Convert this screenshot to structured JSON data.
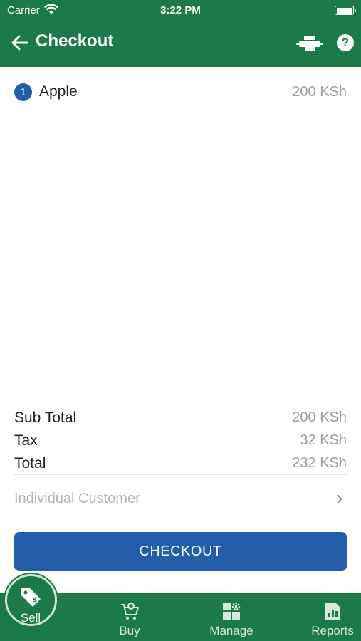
{
  "status_bar": {
    "carrier": "Carrier",
    "time": "3:22 PM"
  },
  "header": {
    "title": "Checkout",
    "back_icon": "arrow-left-icon",
    "print_icon": "printer-icon",
    "help_icon": "help-circle-icon",
    "help_glyph": "?"
  },
  "items": [
    {
      "quantity": "1",
      "name": "Apple",
      "price": "200 KSh"
    }
  ],
  "summary": {
    "subtotal_label": "Sub Total",
    "subtotal_value": "200 KSh",
    "tax_label": "Tax",
    "tax_value": "32 KSh",
    "total_label": "Total",
    "total_value": "232 KSh"
  },
  "customer": {
    "label": "Individual Customer"
  },
  "checkout_button": "CHECKOUT",
  "tabs": [
    {
      "label": "Sell",
      "icon": "tag-icon",
      "active": true
    },
    {
      "label": "Buy",
      "icon": "cart-icon",
      "active": false
    },
    {
      "label": "Manage",
      "icon": "grid-gear-icon",
      "active": false
    },
    {
      "label": "Reports",
      "icon": "report-chart-icon",
      "active": false
    }
  ],
  "colors": {
    "primary_green": "#1b7a47",
    "accent_blue": "#245eaa",
    "muted_text": "#9e9e9e"
  }
}
